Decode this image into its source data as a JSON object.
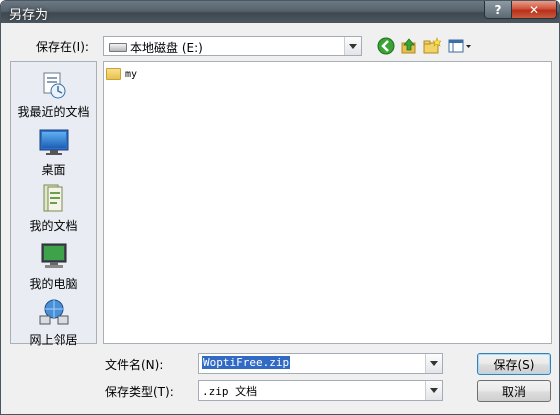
{
  "window": {
    "title": "另存为",
    "help_label": "?",
    "close_label": "✕"
  },
  "save_in": {
    "label": "保存在(I):",
    "value": "本地磁盘 (E:)"
  },
  "places": [
    {
      "label": "我最近的文档",
      "icon": "recent-documents-icon"
    },
    {
      "label": "桌面",
      "icon": "desktop-icon"
    },
    {
      "label": "我的文档",
      "icon": "my-documents-icon"
    },
    {
      "label": "我的电脑",
      "icon": "my-computer-icon"
    },
    {
      "label": "网上邻居",
      "icon": "network-icon"
    }
  ],
  "files": [
    {
      "name": "my",
      "type": "folder"
    }
  ],
  "filename": {
    "label": "文件名(N):",
    "value": "WoptiFree.zip"
  },
  "filetype": {
    "label": "保存类型(T):",
    "value": ".zip 文档"
  },
  "buttons": {
    "save": "保存(S)",
    "cancel": "取消"
  }
}
